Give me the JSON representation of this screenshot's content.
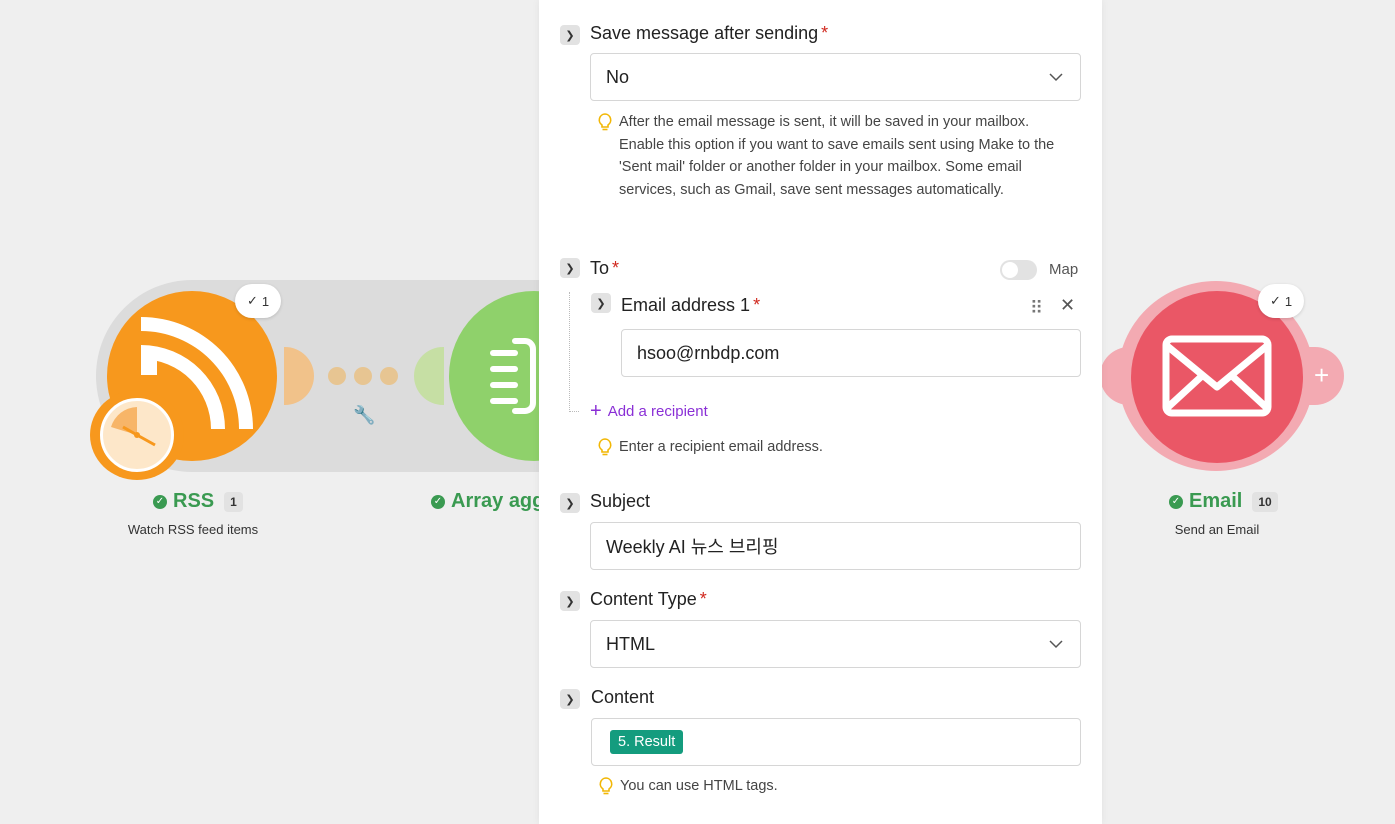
{
  "scenario": {
    "modules": [
      {
        "name": "RSS",
        "count": "1",
        "subtitle": "Watch RSS feed items",
        "run_badge": "1",
        "color": "#f7981d"
      },
      {
        "name": "Array agg",
        "color": "#8fd16b"
      },
      {
        "name": "Email",
        "count": "10",
        "subtitle": "Send an Email",
        "run_badge": "1",
        "color": "#ea5766"
      }
    ]
  },
  "panel": {
    "save_message": {
      "label": "Save message after sending",
      "required": "*",
      "value": "No",
      "hint": "After the email message is sent, it will be saved in your mailbox. Enable this option if you want to save emails sent using Make to the 'Sent mail' folder or another folder in your mailbox. Some email services, such as Gmail, save sent messages automatically."
    },
    "to": {
      "label": "To",
      "required": "*",
      "map_label": "Map",
      "email_label": "Email address 1",
      "email_required": "*",
      "email_value": "hsoo@rnbdp.com",
      "add_recipient": "Add a recipient",
      "hint": "Enter a recipient email address."
    },
    "subject": {
      "label": "Subject",
      "value": "Weekly AI 뉴스 브리핑"
    },
    "content_type": {
      "label": "Content Type",
      "required": "*",
      "value": "HTML"
    },
    "content": {
      "label": "Content",
      "pill": "5. Result",
      "hint": "You can use HTML tags."
    }
  },
  "colors": {
    "accent_purple": "#8a2fd6",
    "success_green": "#3a9a51",
    "pill_teal": "#149c7e",
    "required_red": "#d0271d"
  }
}
